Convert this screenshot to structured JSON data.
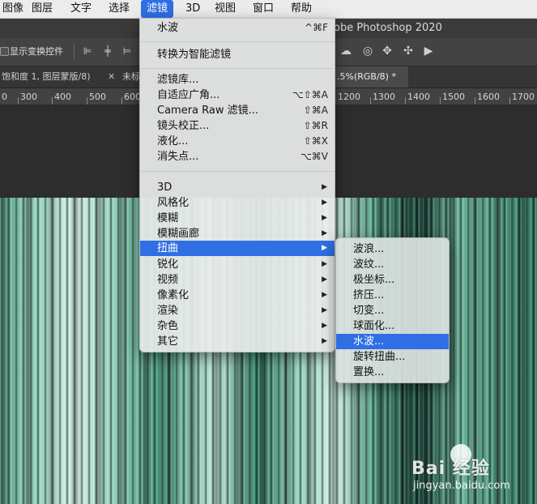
{
  "menubar": {
    "items": [
      "图像",
      "图层",
      "文字",
      "选择",
      "滤镜",
      "3D",
      "视图",
      "窗口",
      "帮助"
    ],
    "active_index": 4
  },
  "window": {
    "title": "obe Photoshop 2020"
  },
  "options_bar": {
    "transform_controls_label": "显示变换控件"
  },
  "tabs": [
    {
      "label": "饱和度 1, 图层蒙版/8)"
    },
    {
      "label": "未标"
    },
    {
      "label": ".5%(RGB/8) *"
    }
  ],
  "ruler": {
    "labels": [
      "0",
      "300",
      "400",
      "500",
      "600",
      "1200",
      "1300",
      "1400",
      "1500",
      "1600",
      "1700"
    ]
  },
  "filter_menu": {
    "items": [
      {
        "label": "水波",
        "shortcut": "^⌘F"
      },
      {
        "label": "转换为智能滤镜"
      },
      {
        "label": "滤镜库..."
      },
      {
        "label": "自适应广角...",
        "shortcut": "⌥⇧⌘A"
      },
      {
        "label": "Camera Raw 滤镜...",
        "shortcut": "⇧⌘A"
      },
      {
        "label": "镜头校正...",
        "shortcut": "⇧⌘R"
      },
      {
        "label": "液化...",
        "shortcut": "⇧⌘X"
      },
      {
        "label": "消失点...",
        "shortcut": "⌥⌘V"
      },
      {
        "label": "3D"
      },
      {
        "label": "风格化"
      },
      {
        "label": "模糊"
      },
      {
        "label": "模糊画廊"
      },
      {
        "label": "扭曲"
      },
      {
        "label": "锐化"
      },
      {
        "label": "视频"
      },
      {
        "label": "像素化"
      },
      {
        "label": "渲染"
      },
      {
        "label": "杂色"
      },
      {
        "label": "其它"
      }
    ],
    "highlighted": "扭曲"
  },
  "distort_submenu": {
    "items": [
      "波浪...",
      "波纹...",
      "极坐标...",
      "挤压...",
      "切变...",
      "球面化...",
      "水波...",
      "旋转扭曲...",
      "置换..."
    ],
    "highlighted": "水波..."
  },
  "watermark": {
    "brand": "Bai  经验",
    "url": "jingyan.baidu.com"
  },
  "colors": {
    "accent": "#2f6fe3",
    "menubar_bg": "#ececec",
    "canvas_teal": "#5aa58d"
  }
}
